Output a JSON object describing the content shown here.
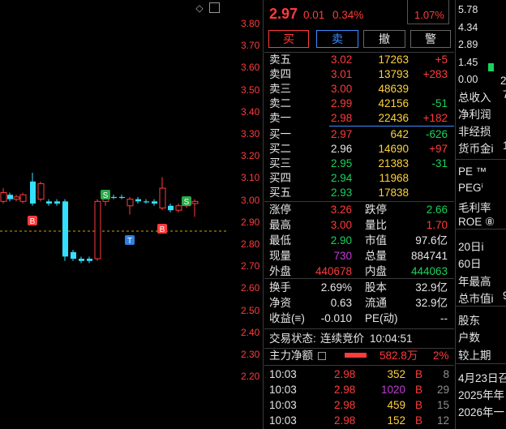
{
  "chart": {
    "top_icons": [
      "diamond-icon",
      "square-icon"
    ],
    "y_ticks": [
      "3.80",
      "3.70",
      "3.60",
      "3.50",
      "3.40",
      "3.30",
      "3.20",
      "3.10",
      "3.00",
      "2.90",
      "2.80",
      "2.70",
      "2.60",
      "2.50",
      "2.40",
      "2.30",
      "2.20"
    ],
    "markers": [
      {
        "label": "B",
        "type": "buy"
      },
      {
        "label": "S",
        "type": "sell"
      },
      {
        "label": "T",
        "type": "t"
      },
      {
        "label": "B",
        "type": "buy"
      },
      {
        "label": "S",
        "type": "sell"
      }
    ]
  },
  "header": {
    "price": "2.97",
    "change": "0.01",
    "change_pct": "0.34%",
    "tag_pct": "1.07%"
  },
  "buttons": {
    "buy": "买",
    "sell": "卖",
    "cancel": "撤",
    "alert": "警"
  },
  "asks": [
    {
      "label": "卖五",
      "price": "3.02",
      "vol": "17263",
      "delta": "+5"
    },
    {
      "label": "卖四",
      "price": "3.01",
      "vol": "13793",
      "delta": "+283"
    },
    {
      "label": "卖三",
      "price": "3.00",
      "vol": "48639",
      "delta": ""
    },
    {
      "label": "卖二",
      "price": "2.99",
      "vol": "42156",
      "delta": "-51"
    },
    {
      "label": "卖一",
      "price": "2.98",
      "vol": "22436",
      "delta": "+182"
    }
  ],
  "bids": [
    {
      "label": "买一",
      "price": "2.97",
      "vol": "642",
      "delta": "-626"
    },
    {
      "label": "买二",
      "price": "2.96",
      "vol": "14690",
      "delta": "+97"
    },
    {
      "label": "买三",
      "price": "2.95",
      "vol": "21383",
      "delta": "-31"
    },
    {
      "label": "买四",
      "price": "2.94",
      "vol": "11968",
      "delta": ""
    },
    {
      "label": "买五",
      "price": "2.93",
      "vol": "17838",
      "delta": ""
    }
  ],
  "stats": [
    {
      "l1": "涨停",
      "v1": "3.26",
      "l2": "跌停",
      "v2": "2.66"
    },
    {
      "l1": "最高",
      "v1": "3.00",
      "l2": "量比",
      "v2": "1.70"
    },
    {
      "l1": "最低",
      "v1": "2.90",
      "l2": "市值",
      "v2": "97.6亿"
    },
    {
      "l1": "现量",
      "v1": "730",
      "l2": "总量",
      "v2": "884741"
    },
    {
      "l1": "外盘",
      "v1": "440678",
      "l2": "内盘",
      "v2": "444063"
    }
  ],
  "stats2": [
    {
      "l1": "换手",
      "v1": "2.69%",
      "l2": "股本",
      "v2": "32.9亿"
    },
    {
      "l1": "净资",
      "v1": "0.63",
      "l2": "流通",
      "v2": "32.9亿"
    },
    {
      "l1": "收益(≡)",
      "v1": "-0.010",
      "l2": "PE(动)",
      "v2": "--"
    }
  ],
  "trade_status": {
    "label": "交易状态:",
    "value": "连续竞价",
    "time": "10:04:51"
  },
  "main_flow": {
    "label": "主力净额",
    "value": "582.8万",
    "pct": "2%"
  },
  "ticks": [
    {
      "time": "10:03",
      "price": "2.98",
      "vol": "352",
      "side": "B",
      "n": "8"
    },
    {
      "time": "10:03",
      "price": "2.98",
      "vol": "1020",
      "side": "B",
      "n": "29"
    },
    {
      "time": "10:03",
      "price": "2.98",
      "vol": "459",
      "side": "B",
      "n": "15"
    },
    {
      "time": "10:03",
      "price": "2.98",
      "vol": "152",
      "side": "B",
      "n": "12"
    }
  ],
  "far": {
    "nums": [
      "5.78",
      "4.34",
      "2.89",
      "1.45",
      "0.00"
    ],
    "side_char": "2",
    "labels": [
      "总收入",
      "净利润",
      "非经损",
      "货币金i",
      "PE ™",
      "PEGⁱ",
      "毛利率",
      "ROE ⑧",
      "20日i",
      "60日",
      "年最高",
      "总市值i",
      "股东",
      "户数",
      "较上期",
      "4月23日召",
      "2025年年",
      "2026年一"
    ],
    "values": [
      "7",
      "",
      "",
      "1",
      "",
      "",
      "",
      "",
      "",
      "",
      "",
      "9",
      "",
      "",
      "",
      "",
      "",
      ""
    ]
  }
}
